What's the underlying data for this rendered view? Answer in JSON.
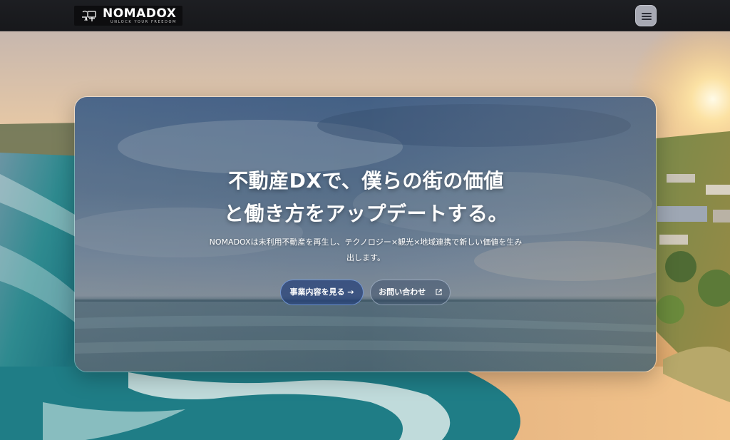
{
  "header": {
    "logo_name": "NOMADOX",
    "logo_tagline": "UNLOCK YOUR FREEDOM",
    "menu_icon": "hamburger-icon"
  },
  "hero": {
    "headline_line1": "不動産DXで、僕らの街の価値",
    "headline_line2": "と働き方をアップデートする。",
    "lede_line1": "NOMADOXは未利用不動産を再生し、テクノロジー×観光×地域連携で新しい価値を生み",
    "lede_line2": "出します。",
    "primary_button": "事業内容を見る →",
    "secondary_button": "お問い合わせ",
    "secondary_icon": "external-link-icon"
  },
  "colors": {
    "header_bg": "#1d1e22",
    "menu_button_bg": "#a7a9b3",
    "primary_button_border": "#82aaeb"
  }
}
